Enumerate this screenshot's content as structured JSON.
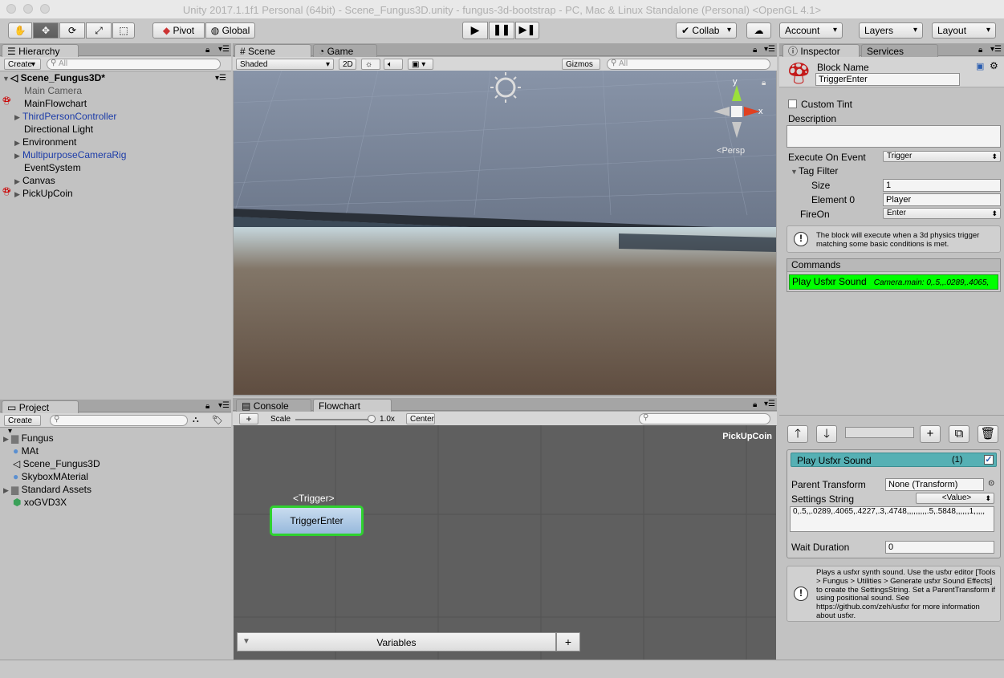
{
  "window": {
    "title": "Unity 2017.1.1f1 Personal (64bit) - Scene_Fungus3D.unity - fungus-3d-bootstrap - PC, Mac & Linux Standalone (Personal) <OpenGL 4.1>"
  },
  "toolbar": {
    "pivot": "Pivot",
    "global": "Global",
    "collab": "Collab",
    "account": "Account",
    "layers": "Layers",
    "layout": "Layout"
  },
  "hierarchy": {
    "tab": "Hierarchy",
    "create": "Create",
    "search_placeholder": "All",
    "scene_name": "Scene_Fungus3D*",
    "items": [
      {
        "label": "Main Camera"
      },
      {
        "label": "MainFlowchart"
      },
      {
        "label": "ThirdPersonController"
      },
      {
        "label": "Directional Light"
      },
      {
        "label": "Environment"
      },
      {
        "label": "MultipurposeCameraRig"
      },
      {
        "label": "EventSystem"
      },
      {
        "label": "Canvas"
      },
      {
        "label": "PickUpCoin"
      }
    ]
  },
  "scene": {
    "tabs": [
      "Scene",
      "Game"
    ],
    "shading": "Shaded",
    "mode_2d": "2D",
    "gizmos": "Gizmos",
    "search_placeholder": "All",
    "gizmo_y": "y",
    "gizmo_x": "x",
    "persp": "Persp"
  },
  "project": {
    "tab": "Project",
    "create": "Create",
    "items": [
      {
        "label": "Fungus"
      },
      {
        "label": "MAt"
      },
      {
        "label": "Scene_Fungus3D"
      },
      {
        "label": "SkyboxMAterial"
      },
      {
        "label": "Standard Assets"
      },
      {
        "label": "xoGVD3X"
      }
    ]
  },
  "flowchart": {
    "tabs": [
      "Console",
      "Flowchart"
    ],
    "add": "+",
    "scale_label": "Scale",
    "scale_value": "1.0x",
    "center": "Center",
    "flowchart_name": "PickUpCoin",
    "block_event": "<Trigger>",
    "block_name": "TriggerEnter",
    "variables": "Variables",
    "variables_add": "+"
  },
  "inspector": {
    "tabs": [
      "Inspector",
      "Services"
    ],
    "block_name_label": "Block Name",
    "block_name_value": "TriggerEnter",
    "custom_tint": "Custom Tint",
    "description": "Description",
    "execute_on_event_label": "Execute On Event",
    "execute_on_event_value": "Trigger",
    "tag_filter": "Tag Filter",
    "size_label": "Size",
    "size_value": "1",
    "element0_label": "Element 0",
    "element0_value": "Player",
    "fireon_label": "FireOn",
    "fireon_value": "Enter",
    "help_text": "The block will execute when a 3d physics trigger matching some basic conditions is met.",
    "commands_label": "Commands",
    "command_name": "Play Usfxr Sound",
    "command_summary": "Camera.main: 0,.5,,.0289,.4065,",
    "command_header": "Play Usfxr Sound",
    "command_index": "(1)",
    "parent_transform_label": "Parent Transform",
    "parent_transform_value": "None (Transform)",
    "settings_string_label": "Settings String",
    "settings_string_mode": "<Value>",
    "settings_string_value": "0,.5,,.0289,.4065,.4227,.3,.4748,,,,,,,,,.5,.5848,,,,,,1,,,,,",
    "wait_duration_label": "Wait Duration",
    "wait_duration_value": "0",
    "cmd_help": "Plays a usfxr synth sound. Use the usfxr editor [Tools > Fungus > Utilities > Generate usfxr Sound Effects] to create the SettingsString. Set a ParentTransform if using positional sound. See https://github.com/zeh/usfxr for more information about usfxr."
  },
  "colors": {
    "command_green": "#00ff00",
    "block_outline": "#2fd12f",
    "command_header": "#56b0b4"
  }
}
